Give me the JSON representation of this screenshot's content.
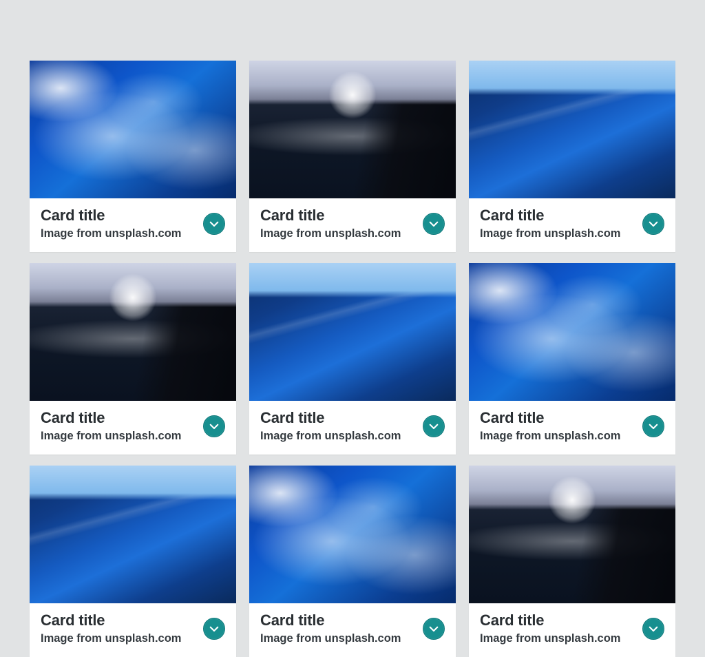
{
  "colors": {
    "accent": "#178f8f",
    "page_bg": "#e1e3e4",
    "card_bg": "#ffffff"
  },
  "cards": [
    {
      "title": "Card title",
      "subtitle": "Image from unsplash.com",
      "image_variant": "ocean-foam"
    },
    {
      "title": "Card title",
      "subtitle": "Image from unsplash.com",
      "image_variant": "ocean-sunset"
    },
    {
      "title": "Card title",
      "subtitle": "Image from unsplash.com",
      "image_variant": "ocean-wave"
    },
    {
      "title": "Card title",
      "subtitle": "Image from unsplash.com",
      "image_variant": "ocean-sunset"
    },
    {
      "title": "Card title",
      "subtitle": "Image from unsplash.com",
      "image_variant": "ocean-wave"
    },
    {
      "title": "Card title",
      "subtitle": "Image from unsplash.com",
      "image_variant": "ocean-foam"
    },
    {
      "title": "Card title",
      "subtitle": "Image from unsplash.com",
      "image_variant": "ocean-wave"
    },
    {
      "title": "Card title",
      "subtitle": "Image from unsplash.com",
      "image_variant": "ocean-foam"
    },
    {
      "title": "Card title",
      "subtitle": "Image from unsplash.com",
      "image_variant": "ocean-sunset"
    }
  ]
}
